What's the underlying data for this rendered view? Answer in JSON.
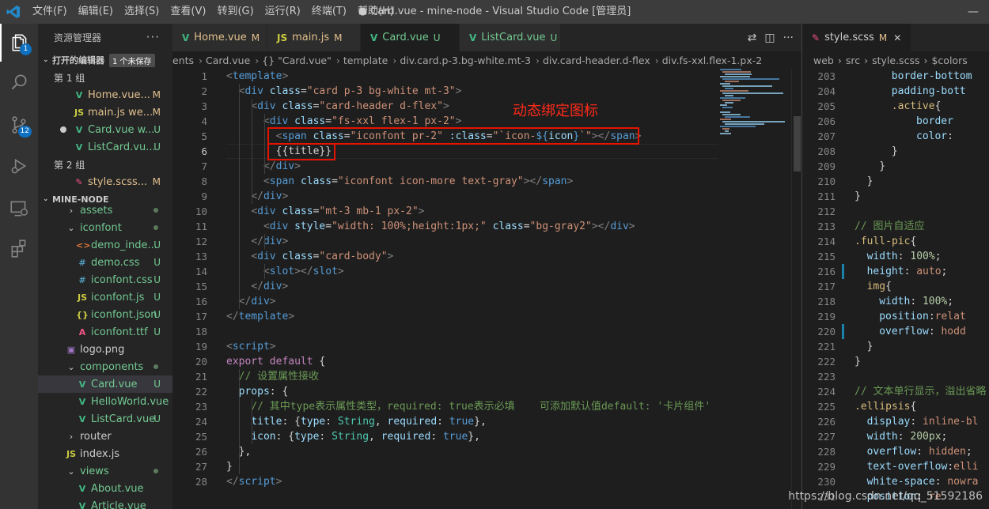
{
  "titlebar": {
    "menu": [
      "文件(F)",
      "编辑(E)",
      "选择(S)",
      "查看(V)",
      "转到(G)",
      "运行(R)",
      "终端(T)",
      "帮助(H)"
    ],
    "title": "● Card.vue - mine-node - Visual Studio Code [管理员]"
  },
  "activity": {
    "explorer_badge": "1",
    "scm_badge": "12"
  },
  "sidebar": {
    "header": "资源管理器",
    "open_editors_label": "打开的编辑器",
    "unsaved_badge": "1 个未保存",
    "group1_label": "第 1 组",
    "group2_label": "第 2 组",
    "open_group1": [
      {
        "icon": "V",
        "name": "Home.vue...",
        "status": "M"
      },
      {
        "icon": "JS",
        "name": "main.js we...",
        "status": "M"
      },
      {
        "icon": "V",
        "name": "Card.vue w...",
        "status": "U"
      },
      {
        "icon": "V",
        "name": "ListCard.vu...",
        "status": "U"
      }
    ],
    "open_group2": [
      {
        "icon": "✎",
        "name": "style.scss...",
        "status": "M"
      }
    ],
    "project_label": "MINE-NODE",
    "tree": [
      {
        "icon": "›",
        "name": "assets",
        "status": ""
      },
      {
        "icon": "⌄",
        "name": "iconfont",
        "status": ""
      },
      {
        "icon": "<>",
        "name": "demo_inde...",
        "status": "U"
      },
      {
        "icon": "#",
        "name": "demo.css",
        "status": "U"
      },
      {
        "icon": "#",
        "name": "iconfont.css",
        "status": "U"
      },
      {
        "icon": "JS",
        "name": "iconfont.js",
        "status": "U"
      },
      {
        "icon": "{}",
        "name": "iconfont.json",
        "status": "U"
      },
      {
        "icon": "A",
        "name": "iconfont.ttf",
        "status": "U"
      },
      {
        "icon": "▣",
        "name": "logo.png",
        "status": ""
      },
      {
        "icon": "⌄",
        "name": "components",
        "status": ""
      },
      {
        "icon": "V",
        "name": "Card.vue",
        "status": "U"
      },
      {
        "icon": "V",
        "name": "HelloWorld.vue",
        "status": ""
      },
      {
        "icon": "V",
        "name": "ListCard.vue",
        "status": "U"
      },
      {
        "icon": "›",
        "name": "router",
        "status": ""
      },
      {
        "icon": "JS",
        "name": "index.js",
        "status": ""
      },
      {
        "icon": "⌄",
        "name": "views",
        "status": ""
      },
      {
        "icon": "V",
        "name": "About.vue",
        "status": ""
      },
      {
        "icon": "V",
        "name": "Article.vue",
        "status": ""
      }
    ]
  },
  "tabs": [
    {
      "icon": "V",
      "name": "Home.vue",
      "status": "M"
    },
    {
      "icon": "JS",
      "name": "main.js",
      "status": "M"
    },
    {
      "icon": "V",
      "name": "Card.vue",
      "status": "U"
    },
    {
      "icon": "V",
      "name": "ListCard.vue",
      "status": "U"
    }
  ],
  "breadcrumb": [
    "ents",
    "Card.vue",
    "{} \"Card.vue\"",
    "template",
    "div.card.p-3.bg-white.mt-3",
    "div.card-header.d-flex",
    "div.fs-xxl.flex-1.px-2"
  ],
  "annotation": "动态绑定图标",
  "code_lines": [
    "1",
    "2",
    "3",
    "4",
    "5",
    "6",
    "7",
    "8",
    "9",
    "10",
    "11",
    "12",
    "13",
    "14",
    "15",
    "16",
    "17",
    "18",
    "19",
    "20",
    "21",
    "22",
    "23",
    "24",
    "25",
    "26",
    "27",
    "28"
  ],
  "right_editor": {
    "tab": {
      "icon": "✎",
      "name": "style.scss",
      "status": "M",
      "close": "✕"
    },
    "breadcrumb": [
      "web",
      "src",
      "style.scss",
      "$colors"
    ],
    "lines": [
      "203",
      "204",
      "205",
      "206",
      "207",
      "208",
      "209",
      "210",
      "211",
      "212",
      "213",
      "214",
      "215",
      "216",
      "217",
      "218",
      "219",
      "220",
      "221",
      "222",
      "223",
      "224",
      "225",
      "226",
      "227",
      "228",
      "229",
      "230",
      "231"
    ]
  },
  "watermark": "https://blog.csdn.net/qq_51592186"
}
